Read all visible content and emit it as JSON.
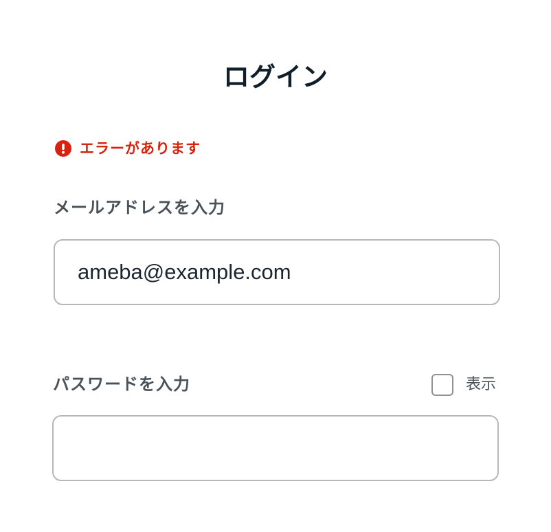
{
  "page": {
    "title": "ログイン"
  },
  "error": {
    "message": "エラーがあります",
    "icon": "alert-circle-icon",
    "color": "#d7220d"
  },
  "email": {
    "label": "メールアドレスを入力",
    "value": "ameba@example.com",
    "placeholder": ""
  },
  "password": {
    "label": "パスワードを入力",
    "value": "",
    "placeholder": "",
    "show_toggle": {
      "label": "表示",
      "checked": false
    }
  }
}
